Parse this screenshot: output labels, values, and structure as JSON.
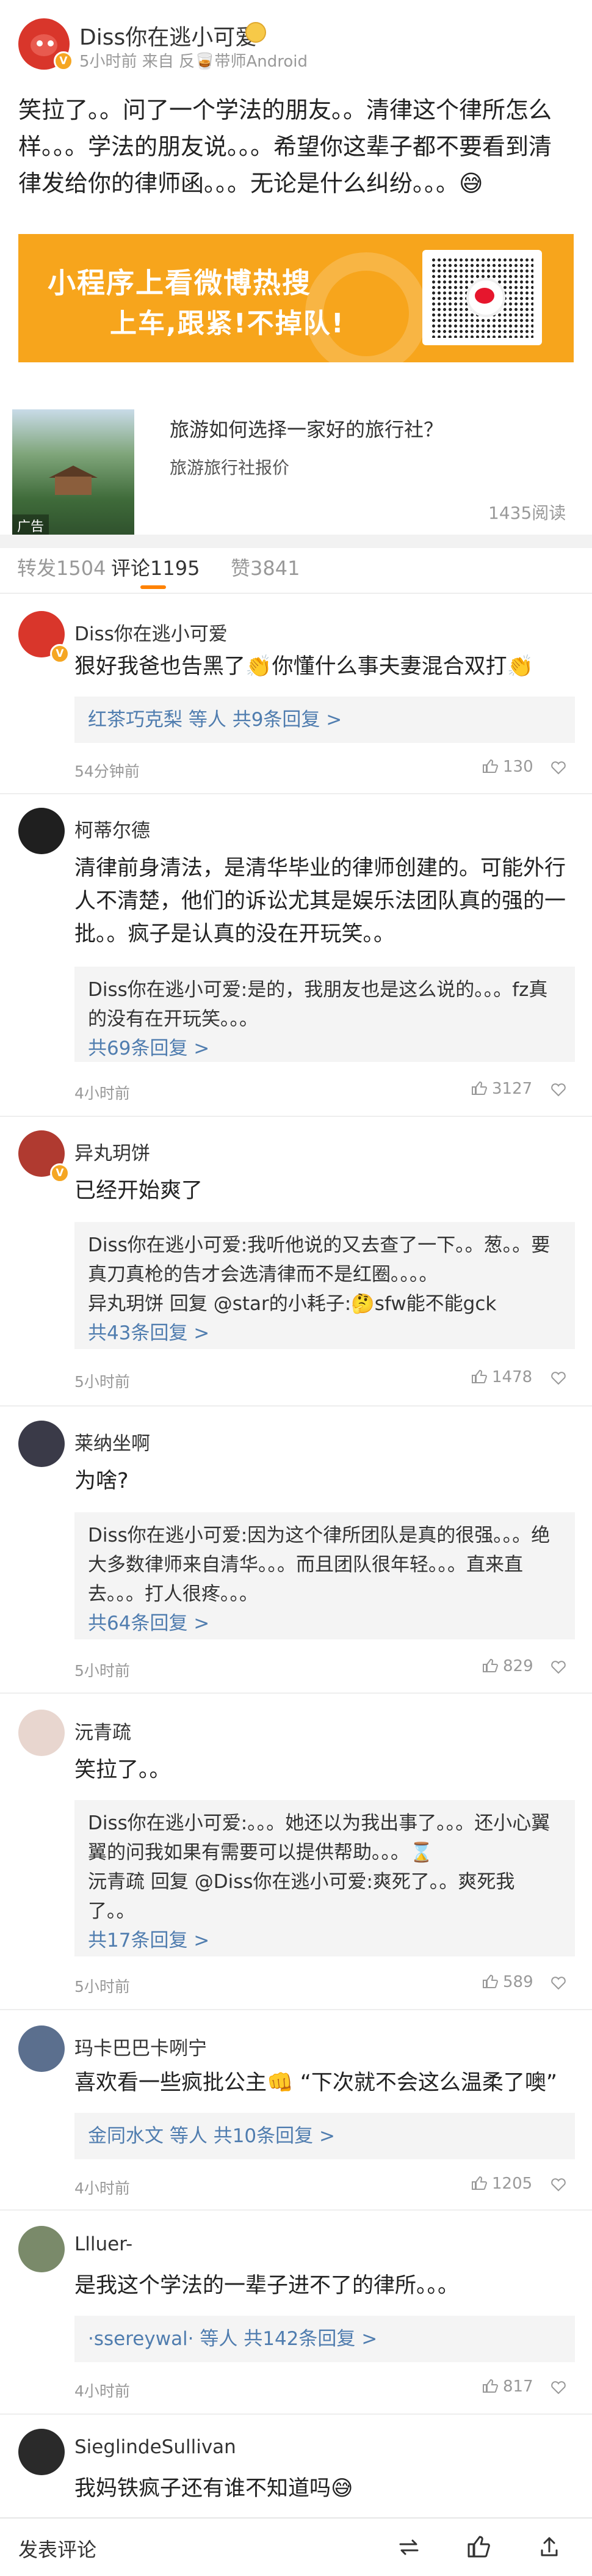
{
  "post": {
    "author": "Diss你在逃小可爱",
    "meta": "5小时前 来自 反🥃带师Android",
    "body": "笑拉了。。问了一个学法的朋友。。清律这个律所怎么样。。。学法的朋友说。。。希望你这辈子都不要看到清律发给你的律师函。。。无论是什么纠纷。。。😅"
  },
  "banner": {
    "line1": "小程序上看微博热搜",
    "line2": "上车,跟紧!不掉队!"
  },
  "ad": {
    "title": "旅游如何选择一家好的旅行社？",
    "subtitle": "旅游旅行社报价",
    "tag": "广告",
    "reads": "1435阅读"
  },
  "tabs": {
    "repost": "转发1504",
    "comment": "评论1195",
    "like": "赞3841"
  },
  "comments": [
    {
      "name": "Diss你在逃小可爱",
      "text": "狠好我爸也告黑了👏你懂什么事夫妻混合双打👏",
      "reply_lines": [
        "红茶巧克梨 等人 共9条回复 >"
      ],
      "time": "54分钟前",
      "likes": "130"
    },
    {
      "name": "柯蒂尔德",
      "text": "清律前身清法，是清华毕业的律师创建的。可能外行人不清楚，他们的诉讼尤其是娱乐法团队真的强的一批。。疯子是认真的没在开玩笑。。",
      "reply_lines": [
        "Diss你在逃小可爱:是的，我朋友也是这么说的。。。fz真的没有在开玩笑。。。",
        "共69条回复 >"
      ],
      "time": "4小时前",
      "likes": "3127"
    },
    {
      "name": "异丸玥饼",
      "text": "已经开始爽了",
      "reply_lines": [
        "Diss你在逃小可爱:我听他说的又去查了一下。。葱。。要真刀真枪的告才会选清律而不是红圈。。。。",
        "异丸玥饼 回复 @star的小耗子:🤔sfw能不能gck",
        "共43条回复 >"
      ],
      "time": "5小时前",
      "likes": "1478"
    },
    {
      "name": "莱纳坐啊",
      "text": "为啥?",
      "reply_lines": [
        "Diss你在逃小可爱:因为这个律所团队是真的很强。。。绝大多数律师来自清华。。。而且团队很年轻。。。直来直去。。。打人很疼。。。",
        "共64条回复 >"
      ],
      "time": "5小时前",
      "likes": "829"
    },
    {
      "name": "沅青疏",
      "text": "笑拉了。。",
      "reply_lines": [
        "Diss你在逃小可爱:。。。她还以为我出事了。。。还小心翼翼的问我如果有需要可以提供帮助。。。⌛",
        "沅青疏 回复 @Diss你在逃小可爱:爽死了。。爽死我了。。",
        "共17条回复 >"
      ],
      "time": "5小时前",
      "likes": "589"
    },
    {
      "name": "玛卡巴巴卡咧宁",
      "text": "喜欢看一些疯批公主👊 “下次就不会这么温柔了噢”",
      "reply_lines": [
        "金同水文 等人 共10条回复 >"
      ],
      "time": "4小时前",
      "likes": "1205"
    },
    {
      "name": "Llluer-",
      "text": "是我这个学法的一辈子进不了的律所。。。",
      "reply_lines": [
        "·ssereywal· 等人 共142条回复 >"
      ],
      "time": "4小时前",
      "likes": "817"
    },
    {
      "name": "SieglindeSullivan",
      "text": "我妈铁疯子还有谁不知道吗😅",
      "reply_lines": [],
      "time": "",
      "likes": ""
    }
  ],
  "bottom_bar": {
    "input_placeholder": "发表评论"
  },
  "colors": {
    "accent": "#ff8200",
    "link": "#507daf",
    "banner": "#f7a51c"
  }
}
